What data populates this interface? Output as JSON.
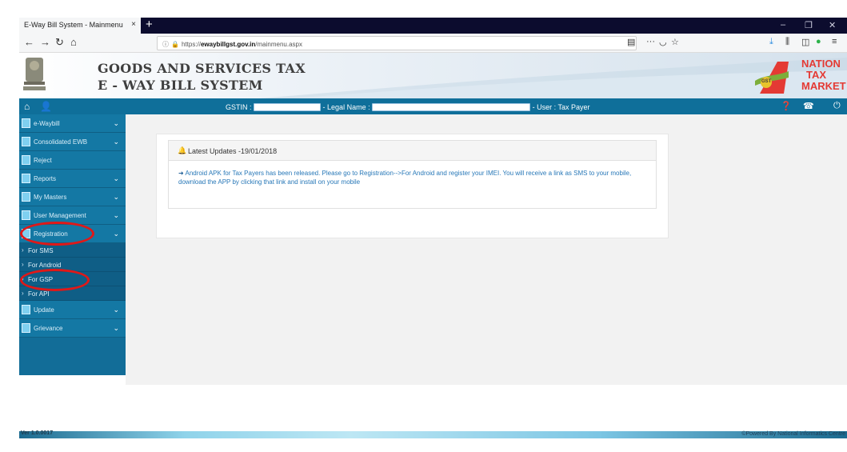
{
  "browser": {
    "tab_title": "E-Way Bill System - Mainmenu",
    "tab_close": "×",
    "new_tab": "+",
    "url_prefix": "https://",
    "url_domain": "ewaybillgst.gov.in",
    "url_path": "/mainmenu.aspx",
    "overflow_icon": "···"
  },
  "header": {
    "title_line1": "GOODS AND SERVICES TAX",
    "title_line2": "E - WAY BILL SYSTEM",
    "logo_line1": "NATION",
    "logo_line2": "TAX",
    "logo_line3": "MARKET",
    "logo_badge": "GST"
  },
  "userbar": {
    "gstin_label": "GSTIN :",
    "legal_name_label": "- Legal Name :",
    "user_label": "- User : Tax Payer"
  },
  "sidebar": {
    "items": [
      {
        "label": "e-Waybill"
      },
      {
        "label": "Consolidated EWB"
      },
      {
        "label": "Reject"
      },
      {
        "label": "Reports"
      },
      {
        "label": "My Masters"
      },
      {
        "label": "User Management"
      },
      {
        "label": "Registration"
      },
      {
        "label": "Update"
      },
      {
        "label": "Grievance"
      }
    ],
    "registration_sub": [
      {
        "label": "For SMS"
      },
      {
        "label": "For Android"
      },
      {
        "label": "For GSP"
      },
      {
        "label": "For API"
      }
    ]
  },
  "updates": {
    "heading": "Latest Updates -19/01/2018",
    "message": "Android APK for Tax Payers has been released. Please go to Registration-->For Android and register your IMEI. You will receive a link as SMS to your mobile, download the APP by clicking that link and install on your mobile"
  },
  "footer": {
    "version": "Ver 1.0.0017",
    "credit": "©Powered By National Informatics Centre"
  }
}
